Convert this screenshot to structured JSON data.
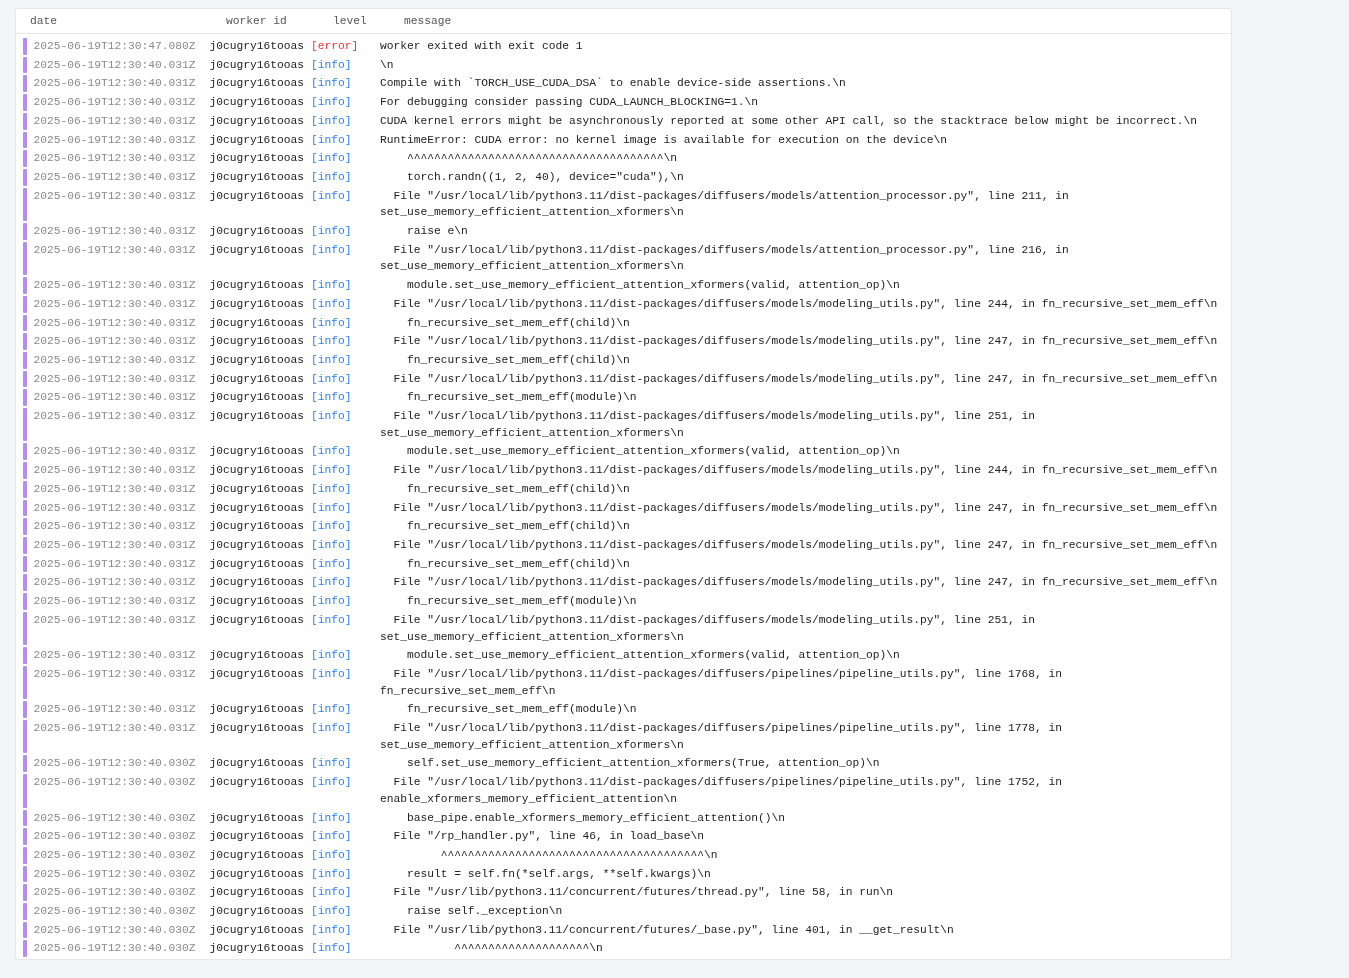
{
  "columns": [
    "date",
    "worker id",
    "level",
    "message"
  ],
  "rows": [
    {
      "date": "2025-06-19T12:30:47.080Z",
      "worker": "j0cugry16tooas",
      "level": "[error]",
      "kind": "error",
      "message": "worker exited with exit code 1"
    },
    {
      "date": "2025-06-19T12:30:40.031Z",
      "worker": "j0cugry16tooas",
      "level": "[info]",
      "kind": "info",
      "message": "\\n"
    },
    {
      "date": "2025-06-19T12:30:40.031Z",
      "worker": "j0cugry16tooas",
      "level": "[info]",
      "kind": "info",
      "message": "Compile with `TORCH_USE_CUDA_DSA` to enable device-side assertions.\\n"
    },
    {
      "date": "2025-06-19T12:30:40.031Z",
      "worker": "j0cugry16tooas",
      "level": "[info]",
      "kind": "info",
      "message": "For debugging consider passing CUDA_LAUNCH_BLOCKING=1.\\n"
    },
    {
      "date": "2025-06-19T12:30:40.031Z",
      "worker": "j0cugry16tooas",
      "level": "[info]",
      "kind": "info",
      "message": "CUDA kernel errors might be asynchronously reported at some other API call, so the stacktrace below might be incorrect.\\n"
    },
    {
      "date": "2025-06-19T12:30:40.031Z",
      "worker": "j0cugry16tooas",
      "level": "[info]",
      "kind": "info",
      "message": "RuntimeError: CUDA error: no kernel image is available for execution on the device\\n"
    },
    {
      "date": "2025-06-19T12:30:40.031Z",
      "worker": "j0cugry16tooas",
      "level": "[info]",
      "kind": "info",
      "message": "    ^^^^^^^^^^^^^^^^^^^^^^^^^^^^^^^^^^^^^^\\n"
    },
    {
      "date": "2025-06-19T12:30:40.031Z",
      "worker": "j0cugry16tooas",
      "level": "[info]",
      "kind": "info",
      "message": "    torch.randn((1, 2, 40), device=\"cuda\"),\\n"
    },
    {
      "date": "2025-06-19T12:30:40.031Z",
      "worker": "j0cugry16tooas",
      "level": "[info]",
      "kind": "info",
      "message": "  File \"/usr/local/lib/python3.11/dist-packages/diffusers/models/attention_processor.py\", line 211, in set_use_memory_efficient_attention_xformers\\n"
    },
    {
      "date": "2025-06-19T12:30:40.031Z",
      "worker": "j0cugry16tooas",
      "level": "[info]",
      "kind": "info",
      "message": "    raise e\\n"
    },
    {
      "date": "2025-06-19T12:30:40.031Z",
      "worker": "j0cugry16tooas",
      "level": "[info]",
      "kind": "info",
      "message": "  File \"/usr/local/lib/python3.11/dist-packages/diffusers/models/attention_processor.py\", line 216, in set_use_memory_efficient_attention_xformers\\n"
    },
    {
      "date": "2025-06-19T12:30:40.031Z",
      "worker": "j0cugry16tooas",
      "level": "[info]",
      "kind": "info",
      "message": "    module.set_use_memory_efficient_attention_xformers(valid, attention_op)\\n"
    },
    {
      "date": "2025-06-19T12:30:40.031Z",
      "worker": "j0cugry16tooas",
      "level": "[info]",
      "kind": "info",
      "message": "  File \"/usr/local/lib/python3.11/dist-packages/diffusers/models/modeling_utils.py\", line 244, in fn_recursive_set_mem_eff\\n"
    },
    {
      "date": "2025-06-19T12:30:40.031Z",
      "worker": "j0cugry16tooas",
      "level": "[info]",
      "kind": "info",
      "message": "    fn_recursive_set_mem_eff(child)\\n"
    },
    {
      "date": "2025-06-19T12:30:40.031Z",
      "worker": "j0cugry16tooas",
      "level": "[info]",
      "kind": "info",
      "message": "  File \"/usr/local/lib/python3.11/dist-packages/diffusers/models/modeling_utils.py\", line 247, in fn_recursive_set_mem_eff\\n"
    },
    {
      "date": "2025-06-19T12:30:40.031Z",
      "worker": "j0cugry16tooas",
      "level": "[info]",
      "kind": "info",
      "message": "    fn_recursive_set_mem_eff(child)\\n"
    },
    {
      "date": "2025-06-19T12:30:40.031Z",
      "worker": "j0cugry16tooas",
      "level": "[info]",
      "kind": "info",
      "message": "  File \"/usr/local/lib/python3.11/dist-packages/diffusers/models/modeling_utils.py\", line 247, in fn_recursive_set_mem_eff\\n"
    },
    {
      "date": "2025-06-19T12:30:40.031Z",
      "worker": "j0cugry16tooas",
      "level": "[info]",
      "kind": "info",
      "message": "    fn_recursive_set_mem_eff(module)\\n"
    },
    {
      "date": "2025-06-19T12:30:40.031Z",
      "worker": "j0cugry16tooas",
      "level": "[info]",
      "kind": "info",
      "message": "  File \"/usr/local/lib/python3.11/dist-packages/diffusers/models/modeling_utils.py\", line 251, in set_use_memory_efficient_attention_xformers\\n"
    },
    {
      "date": "2025-06-19T12:30:40.031Z",
      "worker": "j0cugry16tooas",
      "level": "[info]",
      "kind": "info",
      "message": "    module.set_use_memory_efficient_attention_xformers(valid, attention_op)\\n"
    },
    {
      "date": "2025-06-19T12:30:40.031Z",
      "worker": "j0cugry16tooas",
      "level": "[info]",
      "kind": "info",
      "message": "  File \"/usr/local/lib/python3.11/dist-packages/diffusers/models/modeling_utils.py\", line 244, in fn_recursive_set_mem_eff\\n"
    },
    {
      "date": "2025-06-19T12:30:40.031Z",
      "worker": "j0cugry16tooas",
      "level": "[info]",
      "kind": "info",
      "message": "    fn_recursive_set_mem_eff(child)\\n"
    },
    {
      "date": "2025-06-19T12:30:40.031Z",
      "worker": "j0cugry16tooas",
      "level": "[info]",
      "kind": "info",
      "message": "  File \"/usr/local/lib/python3.11/dist-packages/diffusers/models/modeling_utils.py\", line 247, in fn_recursive_set_mem_eff\\n"
    },
    {
      "date": "2025-06-19T12:30:40.031Z",
      "worker": "j0cugry16tooas",
      "level": "[info]",
      "kind": "info",
      "message": "    fn_recursive_set_mem_eff(child)\\n"
    },
    {
      "date": "2025-06-19T12:30:40.031Z",
      "worker": "j0cugry16tooas",
      "level": "[info]",
      "kind": "info",
      "message": "  File \"/usr/local/lib/python3.11/dist-packages/diffusers/models/modeling_utils.py\", line 247, in fn_recursive_set_mem_eff\\n"
    },
    {
      "date": "2025-06-19T12:30:40.031Z",
      "worker": "j0cugry16tooas",
      "level": "[info]",
      "kind": "info",
      "message": "    fn_recursive_set_mem_eff(child)\\n"
    },
    {
      "date": "2025-06-19T12:30:40.031Z",
      "worker": "j0cugry16tooas",
      "level": "[info]",
      "kind": "info",
      "message": "  File \"/usr/local/lib/python3.11/dist-packages/diffusers/models/modeling_utils.py\", line 247, in fn_recursive_set_mem_eff\\n"
    },
    {
      "date": "2025-06-19T12:30:40.031Z",
      "worker": "j0cugry16tooas",
      "level": "[info]",
      "kind": "info",
      "message": "    fn_recursive_set_mem_eff(module)\\n"
    },
    {
      "date": "2025-06-19T12:30:40.031Z",
      "worker": "j0cugry16tooas",
      "level": "[info]",
      "kind": "info",
      "message": "  File \"/usr/local/lib/python3.11/dist-packages/diffusers/models/modeling_utils.py\", line 251, in set_use_memory_efficient_attention_xformers\\n"
    },
    {
      "date": "2025-06-19T12:30:40.031Z",
      "worker": "j0cugry16tooas",
      "level": "[info]",
      "kind": "info",
      "message": "    module.set_use_memory_efficient_attention_xformers(valid, attention_op)\\n"
    },
    {
      "date": "2025-06-19T12:30:40.031Z",
      "worker": "j0cugry16tooas",
      "level": "[info]",
      "kind": "info",
      "message": "  File \"/usr/local/lib/python3.11/dist-packages/diffusers/pipelines/pipeline_utils.py\", line 1768, in fn_recursive_set_mem_eff\\n"
    },
    {
      "date": "2025-06-19T12:30:40.031Z",
      "worker": "j0cugry16tooas",
      "level": "[info]",
      "kind": "info",
      "message": "    fn_recursive_set_mem_eff(module)\\n"
    },
    {
      "date": "2025-06-19T12:30:40.031Z",
      "worker": "j0cugry16tooas",
      "level": "[info]",
      "kind": "info",
      "message": "  File \"/usr/local/lib/python3.11/dist-packages/diffusers/pipelines/pipeline_utils.py\", line 1778, in set_use_memory_efficient_attention_xformers\\n"
    },
    {
      "date": "2025-06-19T12:30:40.030Z",
      "worker": "j0cugry16tooas",
      "level": "[info]",
      "kind": "info",
      "message": "    self.set_use_memory_efficient_attention_xformers(True, attention_op)\\n"
    },
    {
      "date": "2025-06-19T12:30:40.030Z",
      "worker": "j0cugry16tooas",
      "level": "[info]",
      "kind": "info",
      "message": "  File \"/usr/local/lib/python3.11/dist-packages/diffusers/pipelines/pipeline_utils.py\", line 1752, in enable_xformers_memory_efficient_attention\\n"
    },
    {
      "date": "2025-06-19T12:30:40.030Z",
      "worker": "j0cugry16tooas",
      "level": "[info]",
      "kind": "info",
      "message": "    base_pipe.enable_xformers_memory_efficient_attention()\\n"
    },
    {
      "date": "2025-06-19T12:30:40.030Z",
      "worker": "j0cugry16tooas",
      "level": "[info]",
      "kind": "info",
      "message": "  File \"/rp_handler.py\", line 46, in load_base\\n"
    },
    {
      "date": "2025-06-19T12:30:40.030Z",
      "worker": "j0cugry16tooas",
      "level": "[info]",
      "kind": "info",
      "message": "         ^^^^^^^^^^^^^^^^^^^^^^^^^^^^^^^^^^^^^^^\\n"
    },
    {
      "date": "2025-06-19T12:30:40.030Z",
      "worker": "j0cugry16tooas",
      "level": "[info]",
      "kind": "info",
      "message": "    result = self.fn(*self.args, **self.kwargs)\\n"
    },
    {
      "date": "2025-06-19T12:30:40.030Z",
      "worker": "j0cugry16tooas",
      "level": "[info]",
      "kind": "info",
      "message": "  File \"/usr/lib/python3.11/concurrent/futures/thread.py\", line 58, in run\\n"
    },
    {
      "date": "2025-06-19T12:30:40.030Z",
      "worker": "j0cugry16tooas",
      "level": "[info]",
      "kind": "info",
      "message": "    raise self._exception\\n"
    },
    {
      "date": "2025-06-19T12:30:40.030Z",
      "worker": "j0cugry16tooas",
      "level": "[info]",
      "kind": "info",
      "message": "  File \"/usr/lib/python3.11/concurrent/futures/_base.py\", line 401, in __get_result\\n"
    },
    {
      "date": "2025-06-19T12:30:40.030Z",
      "worker": "j0cugry16tooas",
      "level": "[info]",
      "kind": "info",
      "message": "           ^^^^^^^^^^^^^^^^^^^^\\n"
    }
  ]
}
